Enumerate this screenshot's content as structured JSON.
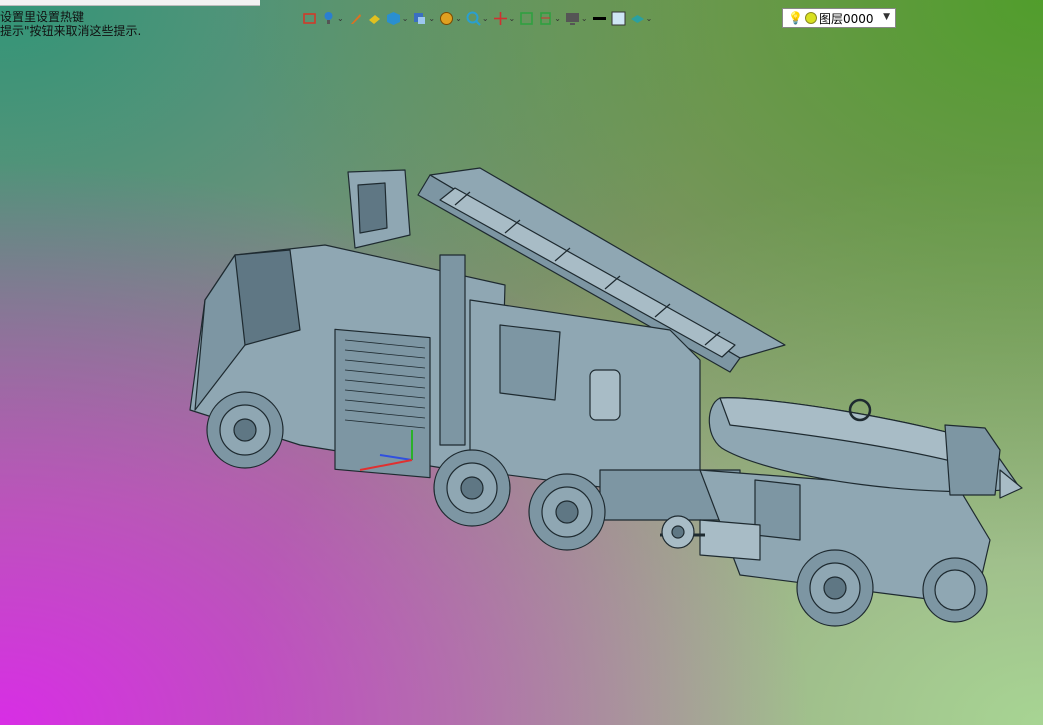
{
  "hint": {
    "line1": "设置里设置热键",
    "line2": "提示\"按钮来取消这些提示."
  },
  "toolbar": {
    "items": [
      {
        "name": "snap-icon",
        "color": "#d03a2a",
        "has_dropdown": false
      },
      {
        "name": "light-bulb-icon",
        "color": "#2a7fd0",
        "has_dropdown": true
      },
      {
        "name": "pencil-icon",
        "color": "#e07020",
        "has_dropdown": false
      },
      {
        "name": "eraser-icon",
        "color": "#e0c020",
        "has_dropdown": false
      },
      {
        "name": "cube-icon",
        "color": "#2a8fd0",
        "has_dropdown": true
      },
      {
        "name": "view-cube-icon",
        "color": "#3a6fc0",
        "has_dropdown": true
      },
      {
        "name": "sphere-icon",
        "color": "#e0a020",
        "has_dropdown": true
      },
      {
        "name": "zoom-icon",
        "color": "#2a9fd0",
        "has_dropdown": true
      },
      {
        "name": "axes-icon",
        "color": "#d03030",
        "has_dropdown": true
      },
      {
        "name": "fit-view-icon",
        "color": "#30a040",
        "has_dropdown": false
      },
      {
        "name": "section-icon",
        "color": "#30a040",
        "has_dropdown": true
      },
      {
        "name": "monitor-icon",
        "color": "#555555",
        "has_dropdown": true
      },
      {
        "name": "line-color-icon",
        "color": "#000000",
        "has_dropdown": false
      },
      {
        "name": "fill-color-icon",
        "color": "#cfe6f5",
        "has_dropdown": false
      },
      {
        "name": "layers-icon",
        "color": "#2aa0a0",
        "has_dropdown": true
      }
    ]
  },
  "layer_select": {
    "value": "图层0000",
    "bulb_color": "#e8c820",
    "dot_color": "#d8e020"
  },
  "colors": {
    "model_fill": "#8fa7b3",
    "model_stroke": "#1e2a30"
  }
}
